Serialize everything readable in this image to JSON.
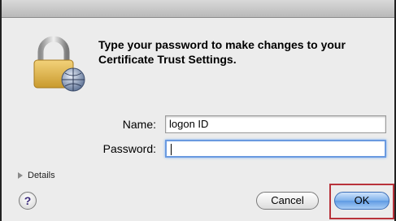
{
  "dialog": {
    "message": "Type your password to make changes to your Certificate Trust Settings.",
    "name_label": "Name:",
    "name_value": "logon ID",
    "password_label": "Password:",
    "password_value": "",
    "details_label": "Details",
    "help_label": "?",
    "cancel_label": "Cancel",
    "ok_label": "OK"
  },
  "icons": {
    "lock": "padlock-icon",
    "details": "disclosure-triangle-icon",
    "help": "help-icon"
  },
  "colors": {
    "default_button": "#5f9ae3",
    "highlight_box": "#b8323a",
    "focus_ring": "#6a9ae0"
  }
}
